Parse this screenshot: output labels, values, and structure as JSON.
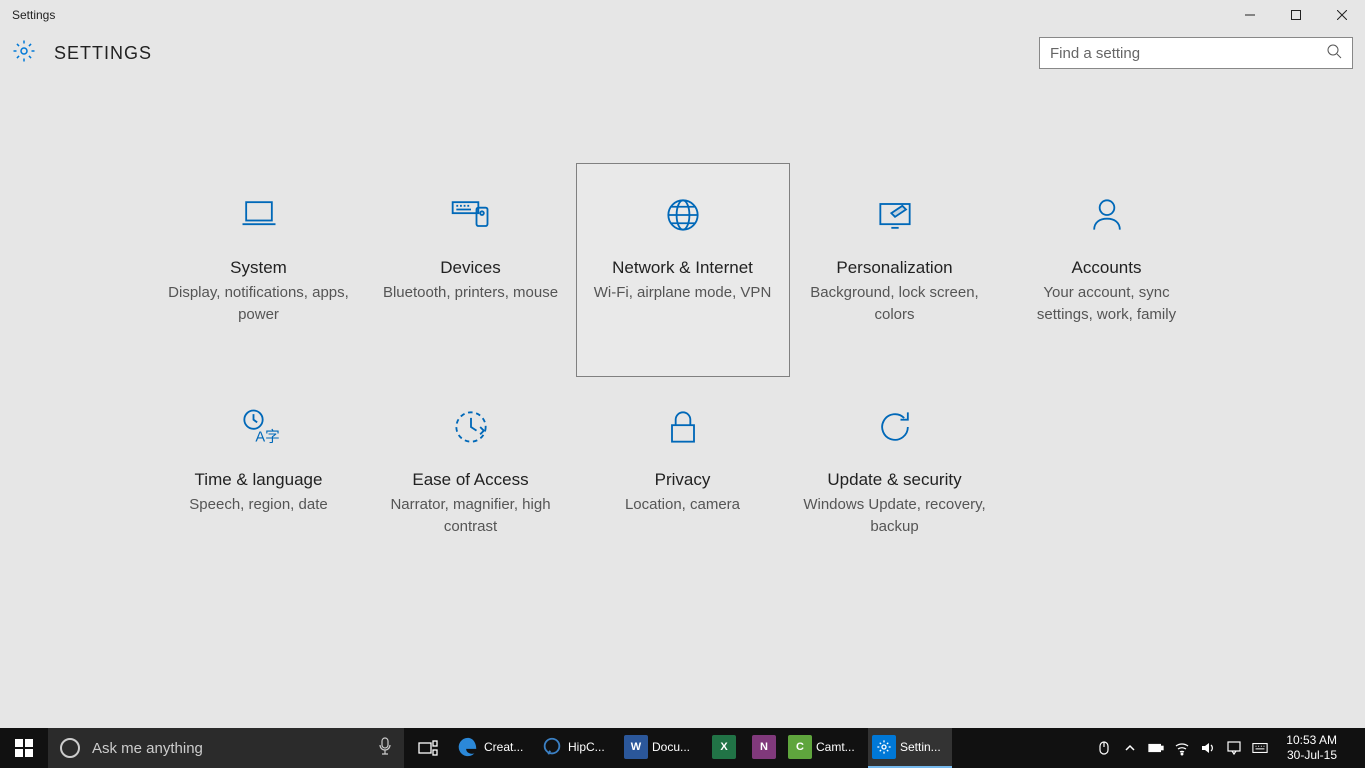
{
  "window": {
    "title": "Settings"
  },
  "header": {
    "title": "SETTINGS",
    "search_placeholder": "Find a setting"
  },
  "tiles": [
    {
      "title": "System",
      "desc": "Display, notifications, apps, power"
    },
    {
      "title": "Devices",
      "desc": "Bluetooth, printers, mouse"
    },
    {
      "title": "Network & Internet",
      "desc": "Wi-Fi, airplane mode, VPN",
      "selected": true
    },
    {
      "title": "Personalization",
      "desc": "Background, lock screen, colors"
    },
    {
      "title": "Accounts",
      "desc": "Your account, sync settings, work, family"
    },
    {
      "title": "Time & language",
      "desc": "Speech, region, date"
    },
    {
      "title": "Ease of Access",
      "desc": "Narrator, magnifier, high contrast"
    },
    {
      "title": "Privacy",
      "desc": "Location, camera"
    },
    {
      "title": "Update & security",
      "desc": "Windows Update, recovery, backup"
    }
  ],
  "taskbar": {
    "cortana_placeholder": "Ask me anything",
    "apps": [
      {
        "label": "Creat...",
        "icon": "edge",
        "color": "#0f62b6"
      },
      {
        "label": "HipC...",
        "icon": "chat",
        "color": "#1c5aa6"
      },
      {
        "label": "Docu...",
        "icon": "W",
        "color": "#2b579a"
      },
      {
        "label": "",
        "icon": "X",
        "color": "#217346"
      },
      {
        "label": "",
        "icon": "N",
        "color": "#80397b"
      },
      {
        "label": "Camt...",
        "icon": "C",
        "color": "#5fa53d"
      },
      {
        "label": "Settin...",
        "icon": "gear",
        "color": "#0078d7",
        "active": true
      }
    ],
    "time": "10:53 AM",
    "date": "30-Jul-15"
  }
}
